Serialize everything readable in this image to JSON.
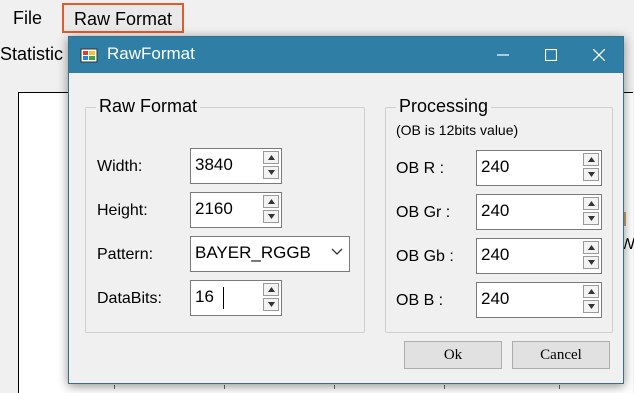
{
  "menu": {
    "file": "File",
    "raw_format": "Raw Format"
  },
  "background": {
    "statistic_label": "Statistic",
    "right_fragment": "W"
  },
  "dialog": {
    "title": "RawFormat",
    "buttons": {
      "minimize": "—",
      "maximize": "☐",
      "close": "✕"
    },
    "raw_format": {
      "group_title": "Raw Format",
      "width_label": "Width:",
      "width_value": "3840",
      "height_label": "Height:",
      "height_value": "2160",
      "pattern_label": "Pattern:",
      "pattern_value": "BAYER_RGGB",
      "databits_label": "DataBits:",
      "databits_value": "16"
    },
    "processing": {
      "group_title": "Processing",
      "note": "(OB is 12bits value)",
      "ob_r_label": "OB R :",
      "ob_r_value": "240",
      "ob_gr_label": "OB Gr :",
      "ob_gr_value": "240",
      "ob_gb_label": "OB Gb :",
      "ob_gb_value": "240",
      "ob_b_label": "OB B :",
      "ob_b_value": "240"
    },
    "ok_label": "Ok",
    "cancel_label": "Cancel"
  },
  "colors": {
    "titlebar": "#2f7ea6",
    "menu_highlight": "#e25b2b"
  }
}
